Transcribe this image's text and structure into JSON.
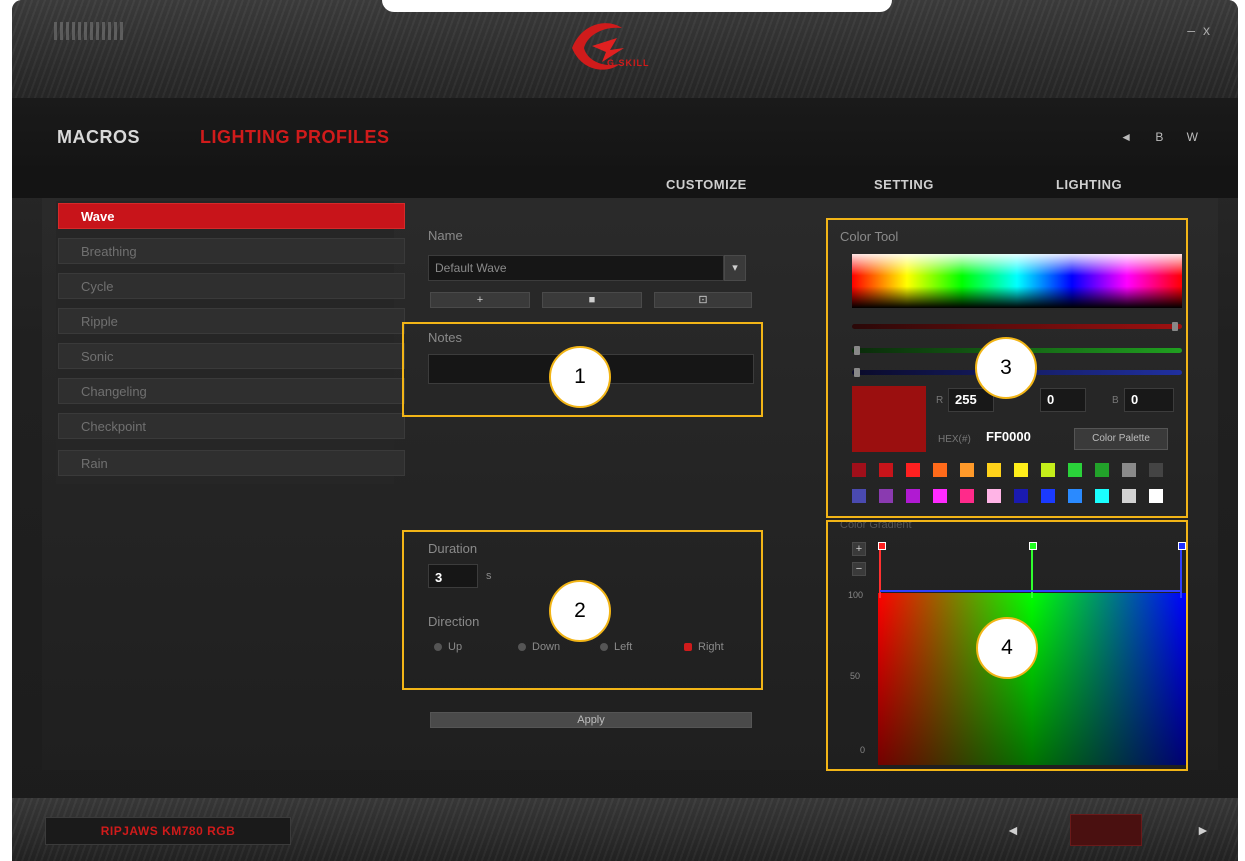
{
  "window": {
    "logo_text": "G.SKILL",
    "minimize_label": "–",
    "close_label": "x"
  },
  "nav": {
    "macros": "MACROS",
    "lighting_profiles": "LIGHTING PROFILES",
    "right_icons": "◄ B W"
  },
  "subtabs": [
    "CUSTOMIZE",
    "SETTING",
    "LIGHTING"
  ],
  "sidebar": {
    "items": [
      {
        "label": "Wave",
        "active": true
      },
      {
        "label": "Breathing"
      },
      {
        "label": "Cycle"
      },
      {
        "label": "Ripple"
      },
      {
        "label": "Sonic"
      },
      {
        "label": "Changeling"
      },
      {
        "label": "Checkpoint"
      },
      {
        "label": "Rain"
      }
    ]
  },
  "profile": {
    "name_label": "Name",
    "name_value": "Default Wave",
    "add_label": "+",
    "remove_label": "■",
    "copy_label": "⊡",
    "notes_label": "Notes",
    "notes_value": ""
  },
  "wave": {
    "duration_label": "Duration",
    "duration_value": "3",
    "duration_unit": "s",
    "direction_label": "Direction",
    "directions": [
      "Up",
      "Down",
      "Left",
      "Right"
    ],
    "selected_direction": "Right",
    "apply_label": "Apply"
  },
  "color_tool": {
    "title": "Color Tool",
    "r_label": "R",
    "r_value": "255",
    "g_value": "0",
    "b_label": "B",
    "b_value": "0",
    "hex_label": "HEX(#)",
    "hex_value": "FF0000",
    "palette_label": "Color Palette",
    "current_color": "#9b0f0f",
    "swatches_row1": [
      "#a00f1a",
      "#c8141a",
      "#ff2020",
      "#ff6a1a",
      "#ff9a2a",
      "#ffd21a",
      "#ffee1a",
      "#c4ee1a",
      "#2ad23a",
      "#22a22a",
      "#8a8a8a",
      "#444444"
    ],
    "swatches_row2": [
      "#4a4ab0",
      "#8a3ab0",
      "#b01ad2",
      "#ff2aff",
      "#ff2a8a",
      "#ffb4e6",
      "#1a1ab0",
      "#1a3aff",
      "#2a8aff",
      "#1affff",
      "#d2d2d2",
      "#ffffff"
    ]
  },
  "gradient": {
    "title": "Color Gradient",
    "add_label": "+",
    "remove_label": "−",
    "y_labels": [
      "100",
      "50",
      "0"
    ],
    "stops": [
      "#ff0000",
      "#00ff00",
      "#0000ff"
    ]
  },
  "callouts": [
    "1",
    "2",
    "3",
    "4"
  ],
  "footer": {
    "device_name": "RIPJAWS KM780 RGB",
    "prev_label": "◄",
    "next_label": "►"
  }
}
